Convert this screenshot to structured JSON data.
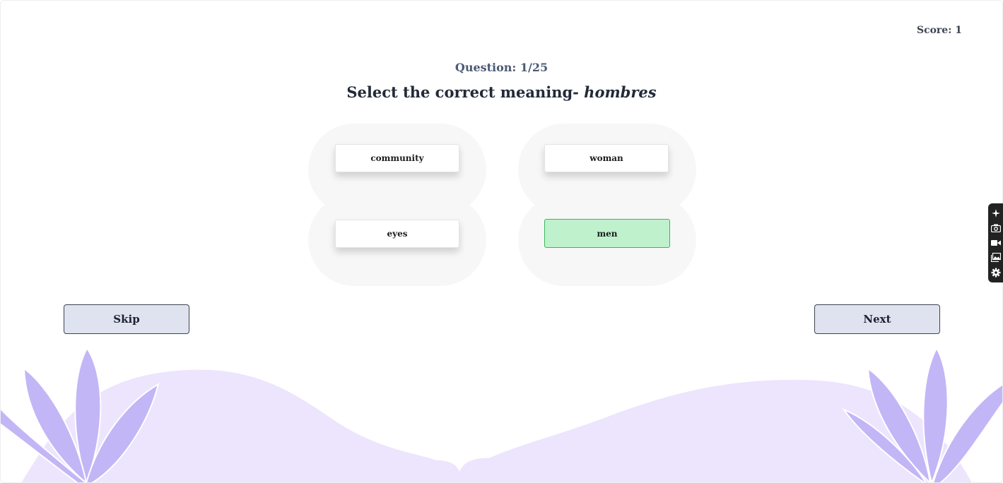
{
  "header": {
    "score_label": "Score: 1"
  },
  "quiz": {
    "question_counter": "Question: 1/25",
    "prompt_prefix": "Select the correct meaning- ",
    "prompt_word": "hombres",
    "options": [
      {
        "label": "community",
        "state": "default"
      },
      {
        "label": "woman",
        "state": "default"
      },
      {
        "label": "eyes",
        "state": "default"
      },
      {
        "label": "men",
        "state": "correct"
      }
    ]
  },
  "navigation": {
    "skip_label": "Skip",
    "next_label": "Next"
  },
  "side_toolbar": {
    "icons": [
      "sparkle-icon",
      "camera-icon",
      "video-icon",
      "gallery-icon",
      "gear-icon"
    ]
  },
  "colors": {
    "correct_fill": "#bff1cd",
    "correct_border": "#36b85b",
    "button_fill": "#dfe3ef",
    "hill_fill": "#ede4fd",
    "plant_fill": "#c3b6f6"
  }
}
